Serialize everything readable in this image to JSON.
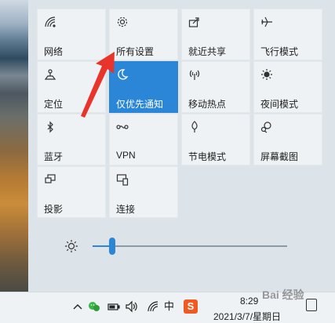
{
  "tiles": [
    {
      "label": "网络",
      "icon": "network-icon",
      "active": false
    },
    {
      "label": "所有设置",
      "icon": "gear-icon",
      "active": false
    },
    {
      "label": "就近共享",
      "icon": "share-icon",
      "active": false
    },
    {
      "label": "飞行模式",
      "icon": "airplane-icon",
      "active": false
    },
    {
      "label": "定位",
      "icon": "location-icon",
      "active": false
    },
    {
      "label": "仅优先通知",
      "icon": "moon-icon",
      "active": true
    },
    {
      "label": "移动热点",
      "icon": "hotspot-icon",
      "active": false
    },
    {
      "label": "夜间模式",
      "icon": "brightness-icon",
      "active": false
    },
    {
      "label": "蓝牙",
      "icon": "bluetooth-icon",
      "active": false
    },
    {
      "label": "VPN",
      "icon": "vpn-icon",
      "active": false
    },
    {
      "label": "节电模式",
      "icon": "battery-saver-icon",
      "active": false
    },
    {
      "label": "屏幕截图",
      "icon": "screen-snip-icon",
      "active": false
    },
    {
      "label": "投影",
      "icon": "project-icon",
      "active": false
    },
    {
      "label": "连接",
      "icon": "connect-icon",
      "active": false
    }
  ],
  "brightness": {
    "icon": "sun-icon",
    "level": 0.1
  },
  "taskbar": {
    "tray_icons": [
      "chevron-up-icon",
      "wechat-icon",
      "battery-icon",
      "volume-icon",
      "wifi-icon",
      "ime-icon",
      "sogou-icon"
    ],
    "ime_label": "中",
    "sogou_label": "S",
    "time": "8:29",
    "date": "2021/3/7/星期日"
  },
  "watermark": "Bai 经验",
  "accent": "#2b86d8",
  "annotation_color": "#e8342b"
}
